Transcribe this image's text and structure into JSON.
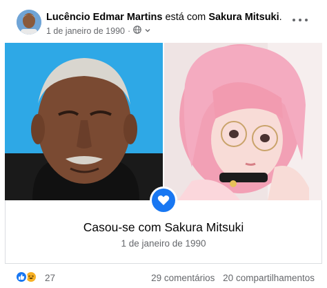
{
  "post": {
    "author": "Lucêncio Edmar Martins",
    "with_text": "está com",
    "tagged": "Sakura Mitsuki",
    "tagged_suffix": ".",
    "date": "1 de janeiro de 1990",
    "meta_separator": "·",
    "privacy_icon": "globe-icon",
    "more_icon": "more-options-icon"
  },
  "event": {
    "icon": "heart-icon",
    "title": "Casou-se com Sakura Mitsuki",
    "date": "1 de janeiro de 1990"
  },
  "footer": {
    "reaction_icons": [
      "like-icon",
      "haha-icon"
    ],
    "reaction_count": "27",
    "comments": "29 comentários",
    "shares": "20 compartilhamentos"
  },
  "colors": {
    "accent": "#1877f2",
    "secondary_text": "#65676b",
    "left_photo_background": "#2ea8e6",
    "right_photo_background": "#f0d5d8",
    "hair": "#f2a0b5"
  }
}
